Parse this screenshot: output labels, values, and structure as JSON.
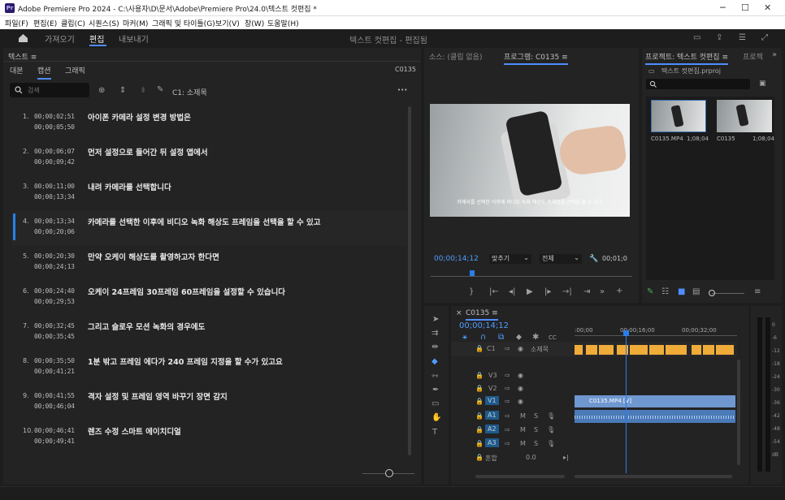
{
  "window": {
    "title": "Adobe Premiere Pro 2024 - C:\\사용자\\D\\문서\\Adobe\\Premiere Pro\\24.0\\텍스트 컷편집 *",
    "minimize": "─",
    "maximize": "☐",
    "close": "✕"
  },
  "menu": [
    "파일(F)",
    "편집(E)",
    "클립(C)",
    "시퀀스(S)",
    "마커(M)",
    "그래픽 및 타이틀(G)",
    "보기(V)",
    "창(W)",
    "도움말(H)"
  ],
  "header": {
    "tabs": [
      "가져오기",
      "편집",
      "내보내기"
    ],
    "active_tab": "편집",
    "project_name": "텍스트 컷편집 - 편집됨"
  },
  "text_panel": {
    "title": "텍스트",
    "menu_glyph": "≡",
    "tabs": [
      "대본",
      "캡션",
      "그래픽"
    ],
    "active_tab": "캡션",
    "sequence": "C0135",
    "search_placeholder": "검색",
    "track_label": "C1: 소제목",
    "more": "•••",
    "captions": [
      {
        "n": "1.",
        "in": "00;00;02;51",
        "out": "00;00;05;50",
        "text": "아이폰 카메라 설정 변경 방법은"
      },
      {
        "n": "2.",
        "in": "00;00;06;07",
        "out": "00;00;09;42",
        "text": "먼저 설정으로 들어간 뒤 설정 앱에서"
      },
      {
        "n": "3.",
        "in": "00;00;11;00",
        "out": "00;00;13;34",
        "text": "내려 카메라를 선택합니다"
      },
      {
        "n": "4.",
        "in": "00;00;13;34",
        "out": "00;00;20;06",
        "text": "카메라를 선택한 이후에 비디오 녹화 해상도 프레임을 선택을 할 수 있고",
        "selected": true
      },
      {
        "n": "5.",
        "in": "00;00;20;30",
        "out": "00;00;24;13",
        "text": "만약 오케이 해상도를 촬영하고자 한다면"
      },
      {
        "n": "6.",
        "in": "00;00;24;40",
        "out": "00;00;29;53",
        "text": "오케이 24프레임 30프레임 60프레임을 설정할 수 있습니다"
      },
      {
        "n": "7.",
        "in": "00;00;32;45",
        "out": "00;00;35;45",
        "text": "그리고 슬로우 모션 녹화의 경우에도"
      },
      {
        "n": "8.",
        "in": "00;00;35;50",
        "out": "00;00;41;21",
        "text": "1분 밖고 프레임 에다가 240 프레임 지정을 할 수가 있고요"
      },
      {
        "n": "9.",
        "in": "00;00;41;55",
        "out": "00;00;46;04",
        "text": "격자 설정 및 프레임 영역 바꾸기 장면 감지"
      },
      {
        "n": "10.",
        "in": "00;00;46;41",
        "out": "00;00;49;41",
        "text": "렌즈 수정 스마트 에이치디얼"
      }
    ]
  },
  "program": {
    "source_tab": "소스: (클립 없음)",
    "program_tab": "프로그램: C0135",
    "menu_glyph": "≡",
    "subtitle": "카메라를 선택한 이후에 비디오 녹화 해상도 프레임을 선택을 할 수 있고",
    "timecode": "00;00;14;12",
    "fit": "맞추기",
    "quality": "전체",
    "duration": "00;01;0"
  },
  "project": {
    "tab": "프로젝트: 텍스트 컷편집",
    "menu_glyph": "≡",
    "tab2": "프로젝",
    "file": "텍스트 컷편집.prproj",
    "items": [
      {
        "name": "C0135.MP4",
        "dur": "1;08;04"
      },
      {
        "name": "C0135",
        "dur": "1;08;04"
      }
    ]
  },
  "timeline": {
    "close": "×",
    "sequence": "C0135",
    "menu_glyph": "≡",
    "timecode": "00;00;14;12",
    "ruler": [
      ":00;00",
      "00;00;16;00",
      "00;00;32;00"
    ],
    "caption_track": {
      "name": "C1",
      "label": "소제목"
    },
    "video_tracks": [
      "V3",
      "V2",
      "V1"
    ],
    "audio_tracks": [
      "A1",
      "A2",
      "A3"
    ],
    "mix": {
      "label": "혼합",
      "value": "0.0"
    },
    "clip_video": "C0135.MP4 [V]",
    "colors": {
      "caption": "#f0ac38",
      "video": "#6f97d0",
      "audio": "#4a7ab8",
      "playhead": "#2b7de9",
      "accent": "#4f8dff"
    }
  },
  "meter": {
    "scale": [
      "0",
      "-6",
      "-12",
      "-18",
      "-24",
      "-30",
      "-36",
      "-42",
      "-48",
      "-54",
      "dB"
    ]
  }
}
